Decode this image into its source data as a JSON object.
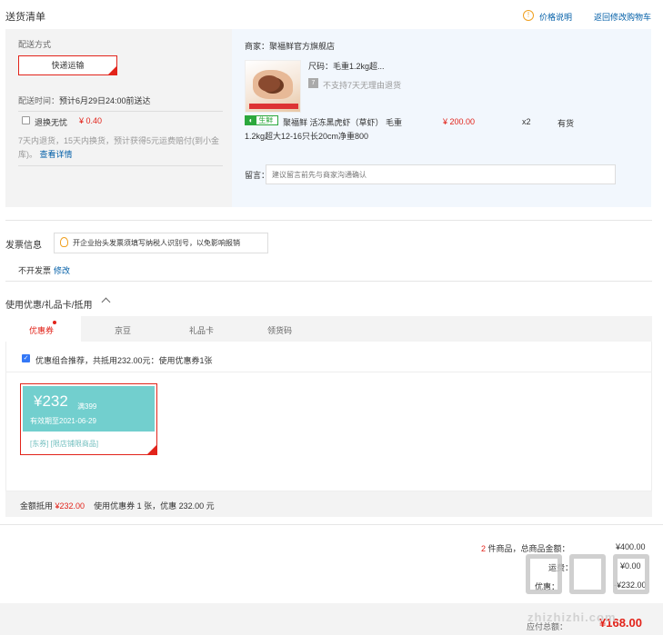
{
  "header": {
    "title": "送货清单",
    "price_help": "价格说明",
    "back_link": "返回修改购物车"
  },
  "shipping": {
    "label": "配送方式",
    "method": "快递运输",
    "time_label": "配送时间：",
    "time_value": "预计6月29日24:00前送达",
    "return_service": "退换无忧",
    "return_price": "¥ 0.40",
    "return_desc": "7天内退货，15天内换货，预计获得5元运费赔付(到小金库)。",
    "return_more": "查看详情"
  },
  "shop": {
    "name": "商家：聚福鲜官方旗舰店",
    "spec": "尺码：毛重1.2kg超...",
    "no_return": "不支持7天无理由退货",
    "fresh_tag": "生鲜",
    "product_title": "聚福鲜 活冻黑虎虾（草虾） 毛重1.2kg超大12-16只长20cm净重800",
    "price": "¥ 200.00",
    "qty": "x2",
    "stock": "有货",
    "remark_label": "留言：",
    "remark_placeholder": "建议留言前先与商家沟通确认"
  },
  "invoice": {
    "title": "发票信息",
    "tip": "开企业抬头发票须填写纳税人识别号，以免影响报销",
    "value": "不开发票",
    "edit": "修改"
  },
  "coupons": {
    "title": "使用优惠/礼品卡/抵用",
    "tabs": [
      "优惠券",
      "京豆",
      "礼品卡",
      "领货码"
    ],
    "combo_text": "优惠组合推荐，共抵用232.00元：使用优惠券1张",
    "coupon": {
      "amount": "¥232",
      "condition": "满399",
      "expiry": "有效期至2021-06-29",
      "tags": "[东券] [限店铺限商品]"
    },
    "footer_label": "金额抵用",
    "footer_amount": "¥232.00",
    "footer_text": "使用优惠券 1 张，优惠 232.00 元"
  },
  "summary": {
    "count": "2",
    "count_label": "件商品，总商品金额：",
    "total": "¥400.00",
    "row2_label": "运费：",
    "row2_value": "¥0.00",
    "row3_label": "优惠：",
    "row3_value": "-¥232.00",
    "final_label": "应付总额：",
    "final_amount": "¥168.00"
  },
  "watermark": {
    "text": "zhizhizhi.com",
    "brand": "值值值"
  },
  "colors": {
    "accent_red": "#e2231a",
    "link_blue": "#005ea7",
    "coupon_teal": "#72cfce",
    "fresh_green": "#2ca83d"
  }
}
